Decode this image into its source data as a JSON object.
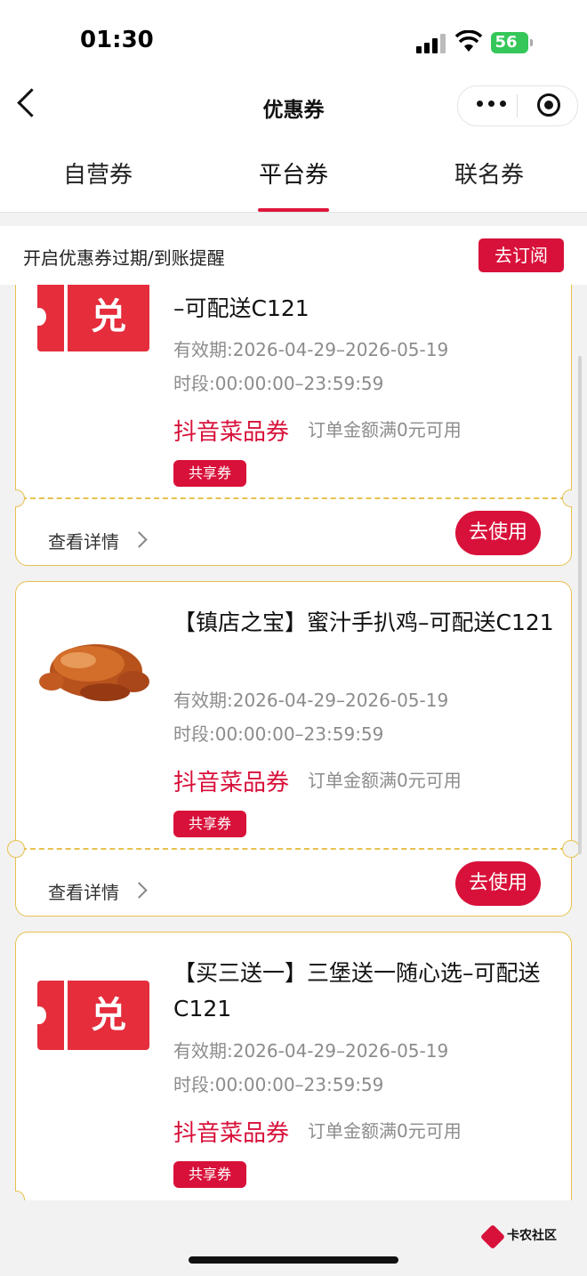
{
  "status_bar": {
    "time": "01:30",
    "battery": "56"
  },
  "nav": {
    "title": "优惠券"
  },
  "tabs": [
    {
      "label": "自营券"
    },
    {
      "label": "平台券",
      "active": true
    },
    {
      "label": "联名券"
    }
  ],
  "reminder": {
    "text": "开启优惠券过期/到账提醒",
    "button": "去订阅"
  },
  "coupons": [
    {
      "title": "–可配送C121",
      "validity": "有效期:2026-04-29–2026-05-19",
      "timeslot": "时段:00:00:00–23:59:59",
      "type": "抖音菜品券",
      "condition": "订单金额满0元可用",
      "badge": "共享券",
      "detail": "查看详情",
      "use": "去使用",
      "icon": "exchange-ticket-icon",
      "icon_text": "兑"
    },
    {
      "title": "【镇店之宝】蜜汁手扒鸡–可配送C121",
      "validity": "有效期:2026-04-29–2026-05-19",
      "timeslot": "时段:00:00:00–23:59:59",
      "type": "抖音菜品券",
      "condition": "订单金额满0元可用",
      "badge": "共享券",
      "detail": "查看详情",
      "use": "去使用",
      "icon": "roast-chicken-image"
    },
    {
      "title": "【买三送一】三堡送一随心选–可配送C121",
      "validity": "有效期:2026-04-29–2026-05-19",
      "timeslot": "时段:00:00:00–23:59:59",
      "type": "抖音菜品券",
      "condition": "订单金额满0元可用",
      "badge": "共享券",
      "icon": "exchange-ticket-icon",
      "icon_text": "兑"
    }
  ],
  "watermark": {
    "text": "卡农社区"
  },
  "colors": {
    "accent": "#d8113a",
    "card_border": "#e7c14e",
    "muted_text": "#8c8c8c"
  }
}
